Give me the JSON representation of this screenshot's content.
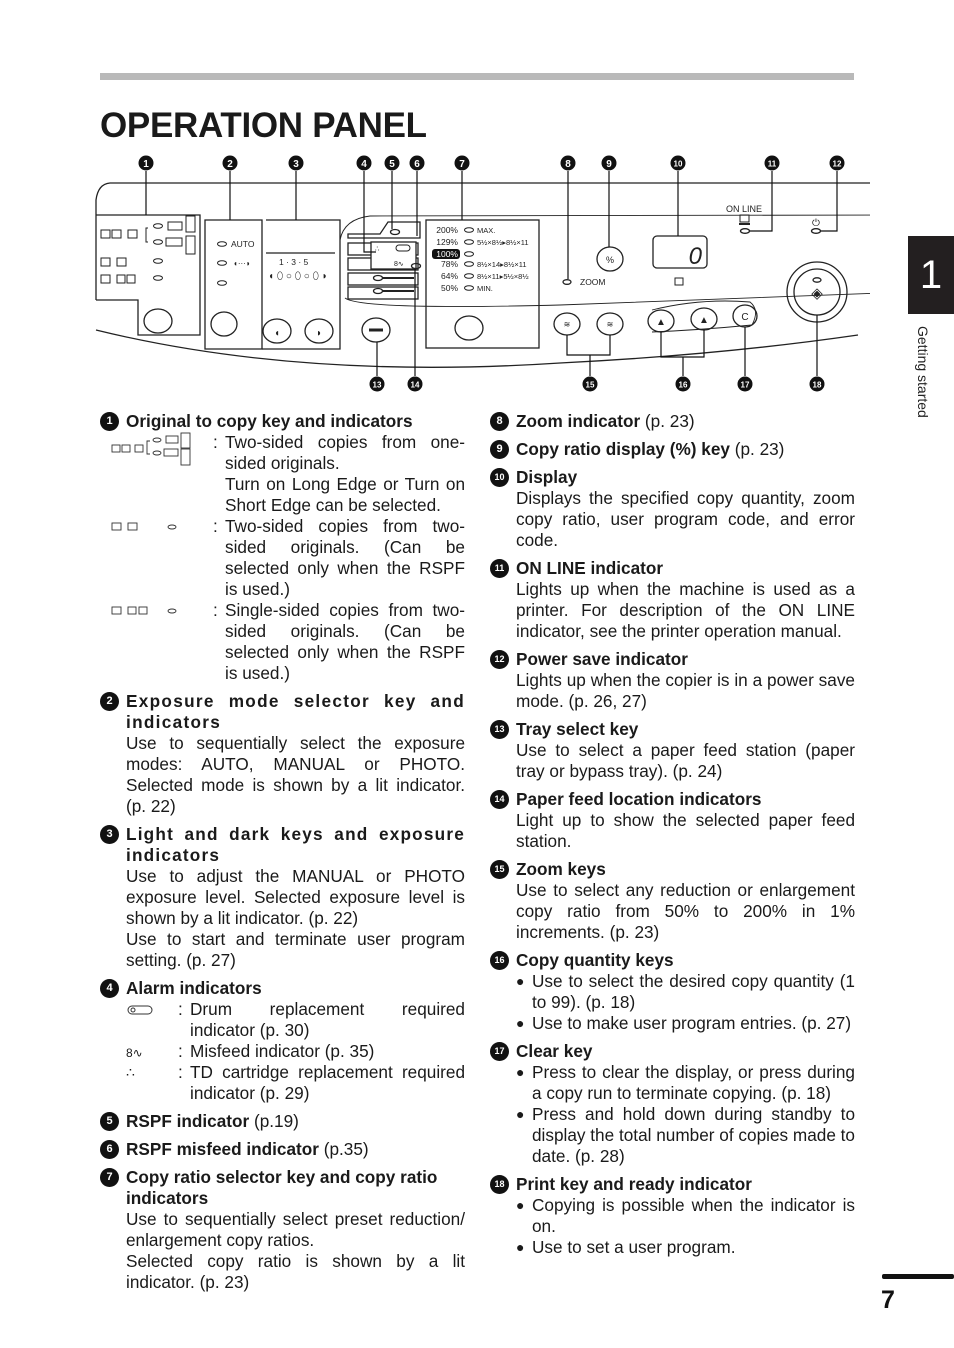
{
  "page": {
    "title": "OPERATION PANEL",
    "chapter_number": "1",
    "chapter_label": "Getting started",
    "page_number": "7"
  },
  "panel": {
    "callouts": [
      "1",
      "2",
      "3",
      "4",
      "5",
      "6",
      "7",
      "8",
      "9",
      "10",
      "11",
      "12",
      "13",
      "14",
      "15",
      "16",
      "17",
      "18"
    ],
    "exposure_auto_label": "AUTO",
    "exposure_scale_label": "1 · 3 · 5",
    "ratio_percents": [
      "200%",
      "129%",
      "100%",
      "78%",
      "64%",
      "50%"
    ],
    "ratio_labels": [
      "MAX.",
      "5½×8½▸8½×11",
      "",
      "8½×14▸8½×11",
      "8½×11▸5½×8½",
      "MIN."
    ],
    "selected_ratio": "100%",
    "zoom_label": "ZOOM",
    "percent_key_label": "%",
    "display_value": "0",
    "online_label": "ON LINE",
    "clear_key_label": "C"
  },
  "items": [
    {
      "num": "1",
      "title": "Original to copy key and indicators",
      "modes": [
        {
          "icon": "one-to-two-sided-icon",
          "lines": [
            "Two-sided copies from one-sided originals.",
            "Turn on Long Edge or Turn on Short Edge can be selected."
          ]
        },
        {
          "icon": "two-to-two-sided-icon",
          "lines": [
            "Two-sided copies from two-sided originals. (Can be selected only when the RSPF is used.)"
          ]
        },
        {
          "icon": "two-to-one-sided-icon",
          "lines": [
            "Single-sided copies from two-sided originals. (Can be selected only when the RSPF is used.)"
          ]
        }
      ]
    },
    {
      "num": "2",
      "title": "Exposure mode selector key and indicators",
      "body": [
        "Use to sequentially select the exposure modes: AUTO, MANUAL or PHOTO. Selected mode is shown by a lit indicator. (p. 22)"
      ]
    },
    {
      "num": "3",
      "title": "Light and dark keys and exposure indicators",
      "body": [
        "Use to adjust the MANUAL or PHOTO exposure level. Selected exposure level is shown by a lit indicator. (p. 22)",
        "Use to start and terminate user program setting. (p. 27)"
      ]
    },
    {
      "num": "4",
      "title": "Alarm indicators",
      "alarms": [
        {
          "icon": "drum-icon",
          "text": "Drum replacement required indicator (p. 30)"
        },
        {
          "icon": "misfeed-icon",
          "text": "Misfeed indicator (p. 35)"
        },
        {
          "icon": "toner-icon",
          "text": "TD cartridge replacement required indicator (p. 29)"
        }
      ]
    },
    {
      "num": "5",
      "title": "RSPF indicator",
      "ref": "(p.19)"
    },
    {
      "num": "6",
      "title": "RSPF misfeed indicator",
      "ref": "(p.35)"
    },
    {
      "num": "7",
      "title": "Copy ratio selector key and copy ratio indicators",
      "body": [
        "Use to sequentially select preset reduction/ enlargement copy ratios.",
        "Selected copy ratio is shown by a lit indicator. (p. 23)"
      ]
    },
    {
      "num": "8",
      "title": "Zoom indicator",
      "ref": "(p. 23)"
    },
    {
      "num": "9",
      "title": "Copy ratio display (%) key",
      "ref": "(p. 23)"
    },
    {
      "num": "10",
      "title": "Display",
      "body": [
        "Displays the specified copy quantity, zoom copy ratio, user program code, and error code."
      ]
    },
    {
      "num": "11",
      "title": "ON LINE indicator",
      "body": [
        "Lights up when the machine is used as a printer. For description of the ON LINE indicator, see the printer operation manual."
      ]
    },
    {
      "num": "12",
      "title": "Power save indicator",
      "body": [
        "Lights up when the copier is in a power save mode. (p. 26, 27)"
      ]
    },
    {
      "num": "13",
      "title": "Tray select key",
      "body": [
        "Use to select a paper feed station (paper tray or bypass tray). (p. 24)"
      ]
    },
    {
      "num": "14",
      "title": "Paper feed location indicators",
      "body": [
        "Light up to show the selected paper feed station."
      ]
    },
    {
      "num": "15",
      "title": "Zoom keys",
      "body": [
        "Use to select any reduction or enlargement copy ratio from 50% to 200% in 1% increments. (p. 23)"
      ]
    },
    {
      "num": "16",
      "title": "Copy quantity keys",
      "bullets": [
        "Use to select the desired copy quantity (1 to 99). (p. 18)",
        "Use to make user program entries. (p. 27)"
      ]
    },
    {
      "num": "17",
      "title": "Clear key",
      "bullets": [
        "Press to clear the display, or press during a copy run to terminate copying. (p. 18)",
        "Press and hold down during standby to display the total number of copies made to date. (p. 28)"
      ]
    },
    {
      "num": "18",
      "title": "Print key and ready indicator",
      "bullets": [
        "Copying is possible when the indicator is on.",
        "Use to set a user program."
      ]
    }
  ]
}
